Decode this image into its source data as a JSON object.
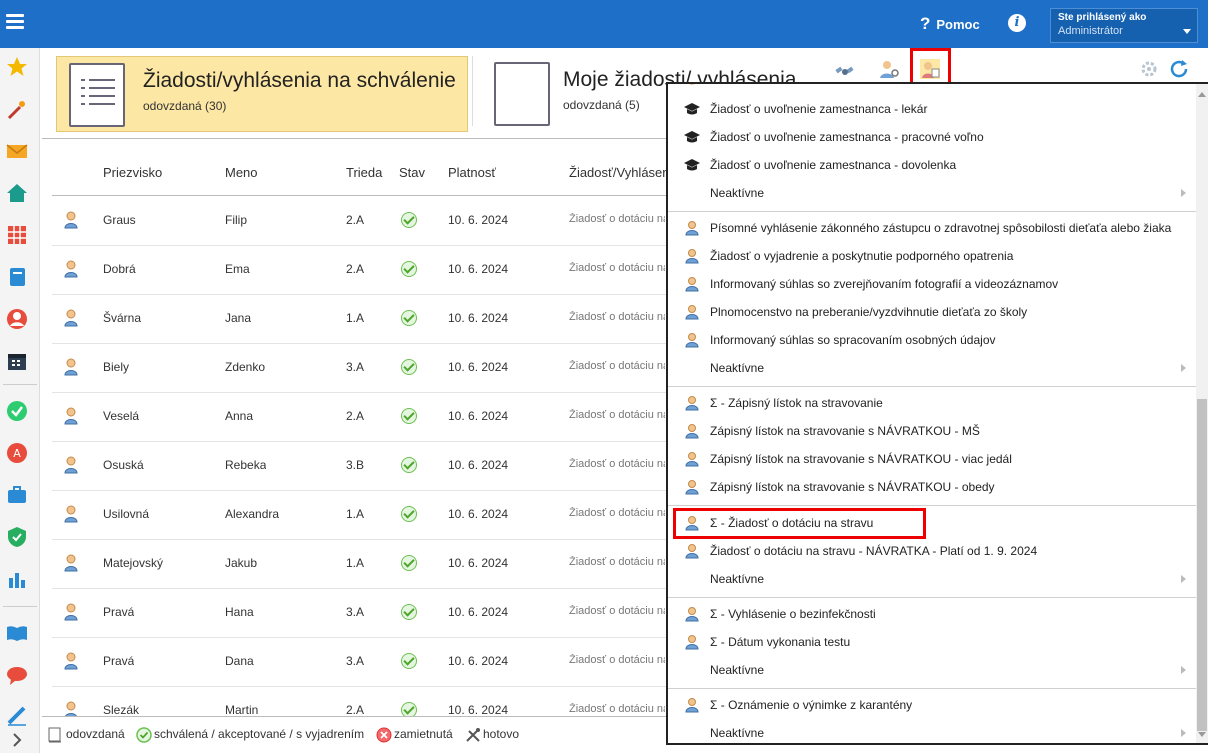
{
  "topbar": {
    "help_label": "Pomoc",
    "help_mark": "?",
    "info_mark": "i",
    "user_line1": "Ste prihlásený ako",
    "user_line2": "Administrátor"
  },
  "sidebar": {
    "icons": [
      "star-icon",
      "magic-wand-icon",
      "envelope-icon",
      "home-icon",
      "timetable-icon",
      "notebook-icon",
      "person-icon",
      "calendar-icon",
      "check-circle-icon",
      "grade-icon",
      "briefcase-icon",
      "shield-icon",
      "chart-icon",
      "book-icon",
      "chat-icon",
      "pencil-icon"
    ]
  },
  "tiles": {
    "approve_title": "Žiadosti/vyhlásenia na schválenie",
    "approve_sub": "odovzdaná (30)",
    "mine_title": "Moje žiadosti/ vyhlásenia",
    "mine_sub": "odovzdaná (5)"
  },
  "table": {
    "headers": [
      "Priezvisko",
      "Meno",
      "Trieda",
      "Stav",
      "Platnosť",
      "Žiadosť/Vyhlásenie"
    ],
    "rows": [
      {
        "surname": "Graus",
        "name": "Filip",
        "class": "2.A",
        "validity": "10. 6. 2024",
        "request": "Žiadosť o dotáciu na stravu"
      },
      {
        "surname": "Dobrá",
        "name": "Ema",
        "class": "2.A",
        "validity": "10. 6. 2024",
        "request": "Žiadosť o dotáciu na stravu"
      },
      {
        "surname": "Švárna",
        "name": "Jana",
        "class": "1.A",
        "validity": "10. 6. 2024",
        "request": "Žiadosť o dotáciu na stravu"
      },
      {
        "surname": "Biely",
        "name": "Zdenko",
        "class": "3.A",
        "validity": "10. 6. 2024",
        "request": "Žiadosť o dotáciu na stravu"
      },
      {
        "surname": "Veselá",
        "name": "Anna",
        "class": "2.A",
        "validity": "10. 6. 2024",
        "request": "Žiadosť o dotáciu na stravu"
      },
      {
        "surname": "Osuská",
        "name": "Rebeka",
        "class": "3.B",
        "validity": "10. 6. 2024",
        "request": "Žiadosť o dotáciu na stravu"
      },
      {
        "surname": "Usilovná",
        "name": "Alexandra",
        "class": "1.A",
        "validity": "10. 6. 2024",
        "request": "Žiadosť o dotáciu na stravu"
      },
      {
        "surname": "Matejovský",
        "name": "Jakub",
        "class": "1.A",
        "validity": "10. 6. 2024",
        "request": "Žiadosť o dotáciu na stravu"
      },
      {
        "surname": "Pravá",
        "name": "Hana",
        "class": "3.A",
        "validity": "10. 6. 2024",
        "request": "Žiadosť o dotáciu na stravu"
      },
      {
        "surname": "Pravá",
        "name": "Dana",
        "class": "3.A",
        "validity": "10. 6. 2024",
        "request": "Žiadosť o dotáciu na stravu"
      },
      {
        "surname": "Slezák",
        "name": "Martin",
        "class": "2.A",
        "validity": "10. 6. 2024",
        "request": "Žiadosť o dotáciu na stravu"
      }
    ]
  },
  "legend": {
    "submitted": "odovzdaná",
    "approved": "schválená / akceptované / s vyjadrením",
    "rejected": "zamietnutá",
    "done": "hotovo"
  },
  "menu": {
    "items": [
      {
        "icon": "graduation-cap-icon",
        "label": "Žiadosť o uvoľnenie zamestnanca - lekár"
      },
      {
        "icon": "graduation-cap-icon",
        "label": "Žiadosť o uvoľnenie zamestnanca - pracovné voľno"
      },
      {
        "icon": "graduation-cap-icon",
        "label": "Žiadosť o uvoľnenie zamestnanca - dovolenka"
      },
      {
        "icon": "",
        "label": "Neaktívne"
      },
      {
        "icon": "person-icon",
        "label": "Písomné vyhlásenie zákonného zástupcu o zdravotnej spôsobilosti dieťaťa alebo žiaka"
      },
      {
        "icon": "person-icon",
        "label": "Žiadosť o vyjadrenie a poskytnutie podporného opatrenia"
      },
      {
        "icon": "person-icon",
        "label": "Informovaný súhlas so zverejňovaním fotografií a videozáznamov"
      },
      {
        "icon": "person-icon",
        "label": "Plnomocenstvo na preberanie/vyzdvihnutie dieťaťa zo školy"
      },
      {
        "icon": "person-icon",
        "label": "Informovaný súhlas so spracovaním osobných údajov"
      },
      {
        "icon": "",
        "label": "Neaktívne"
      },
      {
        "icon": "person-icon",
        "label": "Σ - Zápisný lístok na stravovanie"
      },
      {
        "icon": "person-icon",
        "label": "Zápisný lístok na stravovanie s NÁVRATKOU - MŠ"
      },
      {
        "icon": "person-icon",
        "label": "Zápisný lístok na stravovanie s NÁVRATKOU - viac jedál"
      },
      {
        "icon": "person-icon",
        "label": "Zápisný lístok na stravovanie s NÁVRATKOU - obedy"
      },
      {
        "icon": "person-icon",
        "label": "Σ - Žiadosť o dotáciu na stravu"
      },
      {
        "icon": "person-icon",
        "label": "Žiadosť o dotáciu na stravu - NÁVRATKA - Platí od 1. 9. 2024"
      },
      {
        "icon": "",
        "label": "Neaktívne"
      },
      {
        "icon": "person-icon",
        "label": "Σ - Vyhlásenie o bezinfekčnosti"
      },
      {
        "icon": "person-icon",
        "label": "Σ - Dátum vykonania testu"
      },
      {
        "icon": "",
        "label": "Neaktívne"
      },
      {
        "icon": "person-icon",
        "label": "Σ - Oznámenie o výnimke z karantény"
      },
      {
        "icon": "",
        "label": "Neaktívne"
      }
    ]
  },
  "colors": {
    "topbar": "#1d6fc7",
    "tile_active": "#fde7a5",
    "highlight": "#ee0000",
    "ok_green": "#4da52c"
  }
}
